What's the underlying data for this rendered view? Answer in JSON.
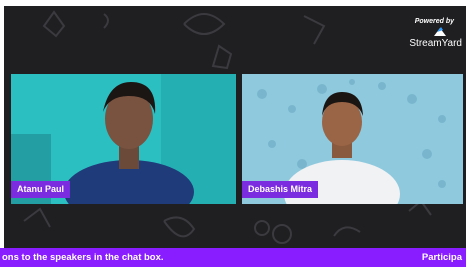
{
  "branding": {
    "powered_by": "Powered by",
    "product": "StreamYard"
  },
  "participants": [
    {
      "name": "Atanu Paul",
      "background": "#2bbfc2"
    },
    {
      "name": "Debashis Mitra",
      "background": "#8fc9de"
    }
  ],
  "ticker": {
    "text": "ons to the speakers in the chat box.",
    "right_text": "Participa"
  },
  "colors": {
    "accent": "#7b2be0",
    "ticker_bg": "#8a1dff",
    "canvas_bg": "#1f1f22"
  }
}
